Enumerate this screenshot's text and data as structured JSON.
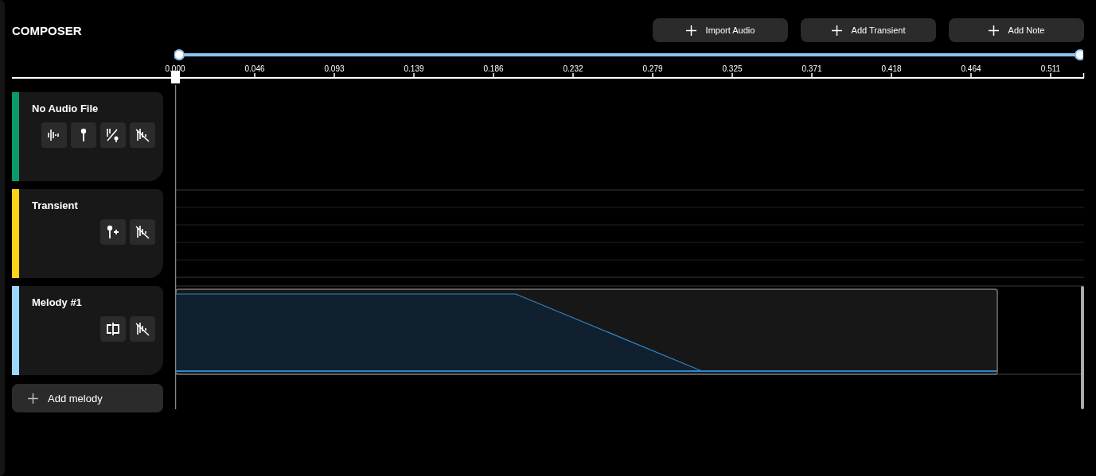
{
  "title": "COMPOSER",
  "actions": [
    {
      "label": "Import Audio"
    },
    {
      "label": "Add Transient"
    },
    {
      "label": "Add Note"
    }
  ],
  "range": {
    "level": 1
  },
  "ruler": {
    "ticks": [
      "0.000",
      "0.046",
      "0.093",
      "0.139",
      "0.186",
      "0.232",
      "0.279",
      "0.325",
      "0.371",
      "0.418",
      "0.464",
      "0.511"
    ]
  },
  "tracks": [
    {
      "kind": "audio",
      "name": "No Audio File",
      "color": "#0a9a6e"
    },
    {
      "kind": "transient",
      "name": "Transient",
      "color": "#ffd21a"
    },
    {
      "kind": "melody",
      "name": "Melody #1",
      "color": "#9bd8ff"
    }
  ],
  "add_melody": {
    "label": "Add melody"
  }
}
